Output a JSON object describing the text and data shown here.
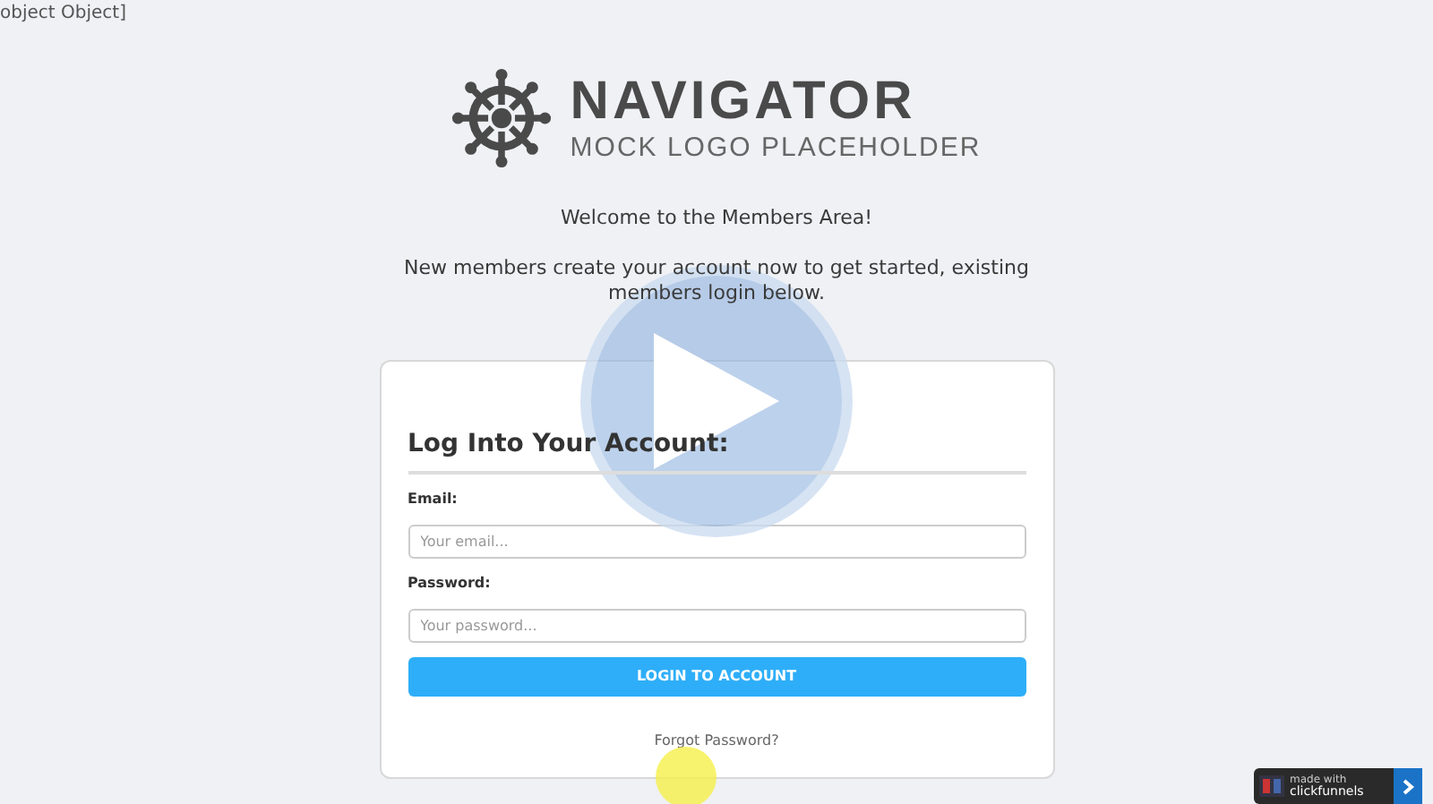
{
  "debug_text": "object Object]",
  "logo": {
    "title": "NAVIGATOR",
    "subtitle": "MOCK LOGO PLACEHOLDER"
  },
  "welcome": "Welcome to the Members Area!",
  "intro": "New members create your account now to get started, existing members login below.",
  "login_card": {
    "heading": "Log Into Your Account:",
    "fields": [
      {
        "label": "Email:",
        "placeholder": "Your email..."
      },
      {
        "label": "Password:",
        "placeholder": "Your password..."
      }
    ],
    "submit": "LOGIN TO ACCOUNT",
    "forgot_link": "Forgot Password?"
  },
  "badge": {
    "small": "made with",
    "brand": "clickfunnels"
  }
}
